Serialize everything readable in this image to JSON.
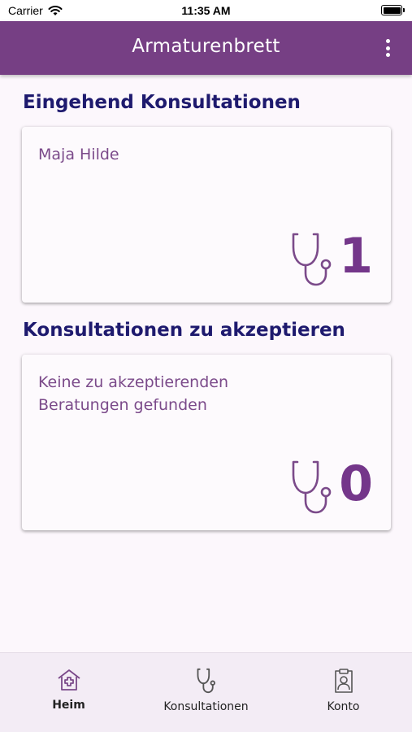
{
  "status_bar": {
    "carrier": "Carrier",
    "time": "11:35 AM"
  },
  "app_bar": {
    "title": "Armaturenbrett",
    "menu_icon": "more-vertical-icon"
  },
  "sections": [
    {
      "title": "Eingehend Konsultationen",
      "card_text": "Maja Hilde",
      "count": "1",
      "icon": "stethoscope-icon"
    },
    {
      "title": "Konsultationen zu akzeptieren",
      "card_text": "Keine zu akzeptierenden Beratungen gefunden",
      "count": "0",
      "icon": "stethoscope-icon"
    }
  ],
  "bottom_nav": {
    "items": [
      {
        "label": "Heim",
        "icon": "home-medical-icon",
        "active": true
      },
      {
        "label": "Konsultationen",
        "icon": "stethoscope-icon",
        "active": false
      },
      {
        "label": "Konto",
        "icon": "clipboard-user-icon",
        "active": false
      }
    ]
  },
  "colors": {
    "primary": "#763f84",
    "heading": "#1e1a6e",
    "card_text": "#7b4a8a",
    "count": "#74368a",
    "background": "#fcf7fc",
    "nav_bg": "#f3ecf5"
  }
}
